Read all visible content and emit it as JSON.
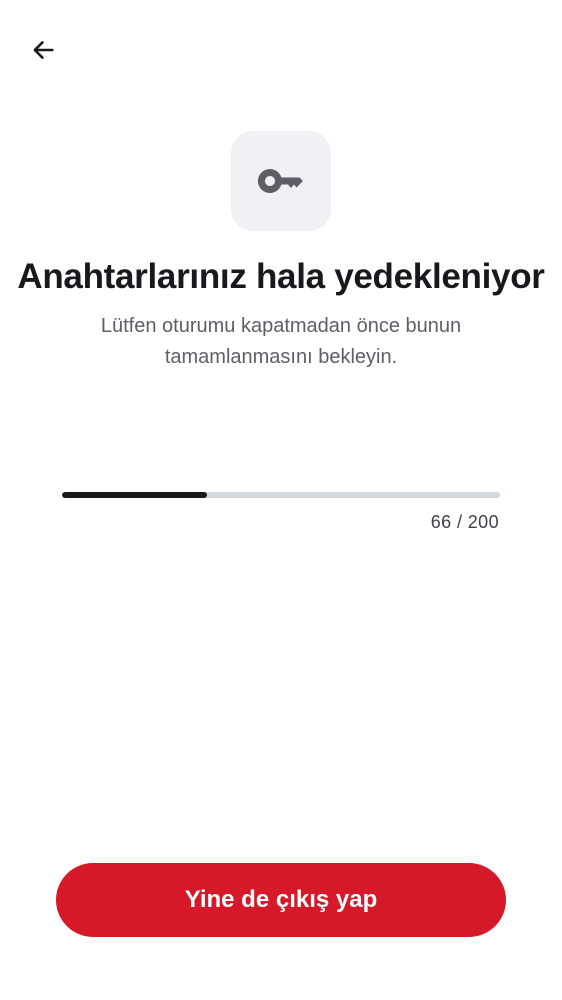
{
  "icons": {
    "back": "arrow-left-icon",
    "key": "key-icon"
  },
  "header": {
    "title": "Anahtarlarınız hala yedekleniyor",
    "subtitle": "Lütfen oturumu kapatmadan önce bunun tamamlanmasını bekleyin."
  },
  "progress": {
    "current": 66,
    "total": 200,
    "label": "66 / 200"
  },
  "actions": {
    "signout_label": "Yine de çıkış yap"
  },
  "colors": {
    "accent": "#d51928",
    "progress_fill": "#17191c",
    "progress_track": "#d3d8de",
    "icon_tile": "#f0f1f5",
    "icon": "#5c6066"
  }
}
